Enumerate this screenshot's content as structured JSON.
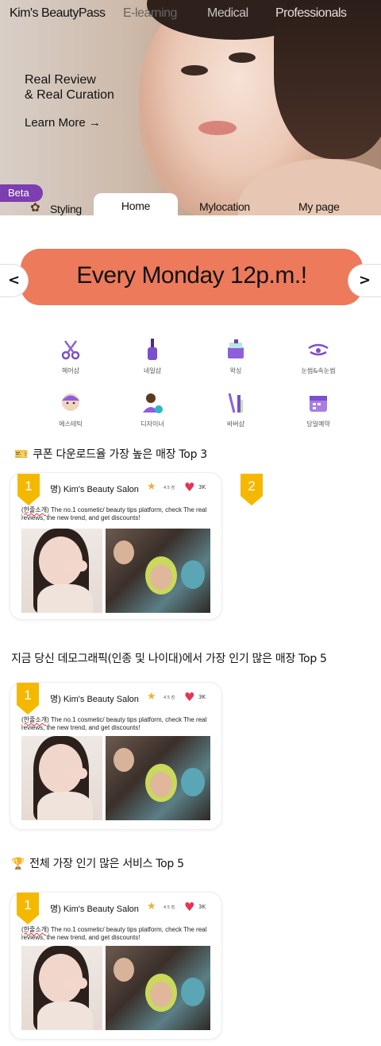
{
  "topnav": {
    "brand": "Kim's BeautyPass",
    "elearning": "E-learning",
    "medical": "Medical",
    "professionals": "Professionals"
  },
  "hero": {
    "headline_line1": "Real Review",
    "headline_line2": "& Real Curation",
    "cta": "Learn More →"
  },
  "beta": "Beta",
  "tabs": {
    "styling": "Styling",
    "home": "Home",
    "mylocation": "Mylocation",
    "mypage": "My page"
  },
  "banner": {
    "text": "Every Monday 12p.m.!",
    "prev": "<",
    "next": ">",
    "color": "#ec7a5b"
  },
  "categories": [
    {
      "label": "헤어샵",
      "icon": "scissors-icon"
    },
    {
      "label": "네일샵",
      "icon": "nail-polish-icon"
    },
    {
      "label": "왁싱",
      "icon": "wax-icon"
    },
    {
      "label": "눈썹&속눈썹",
      "icon": "eyelash-icon"
    },
    {
      "label": "에스테틱",
      "icon": "face-mask-icon"
    },
    {
      "label": "디자이너",
      "icon": "designer-icon"
    },
    {
      "label": "바버샵",
      "icon": "barber-icon"
    },
    {
      "label": "당일예약",
      "icon": "calendar-icon"
    }
  ],
  "sections": [
    {
      "title": "쿠폰 다운로드율 가장 높은 매장 Top 3",
      "card": {
        "rank": "1",
        "name": "명) Kim's Beauty Salon",
        "rating": "4.5 점",
        "likes": "3K",
        "tag": "(한줄소개)",
        "desc": " The no.1 cosmetic/ beauty tips platform, check The real reviews, the new trend, and get discounts!"
      },
      "second_rank": "2"
    },
    {
      "title": "지금 당신 데모그래픽(인종 및 나이대)에서 가장 인기 많은 매장 Top 5",
      "card": {
        "rank": "1",
        "name": "명) Kim's Beauty Salon",
        "rating": "4.5 점",
        "likes": "3K",
        "tag": "(한줄소개)",
        "desc": " The no.1 cosmetic/ beauty tips platform, check The real reviews, the new trend, and get discounts!"
      }
    },
    {
      "title": "전체 가장 인기 많은 서비스 Top 5",
      "card": {
        "rank": "1",
        "name": "명) Kim's Beauty Salon",
        "rating": "4.5 점",
        "likes": "3K",
        "tag": "(한줄소개)",
        "desc": " The no.1 cosmetic/ beauty tips platform, check The real reviews, the new trend, and get discounts!"
      }
    }
  ],
  "colors": {
    "accent_purple": "#7c3eb0",
    "badge_yellow": "#f5b800",
    "heart_red": "#e8334f"
  }
}
